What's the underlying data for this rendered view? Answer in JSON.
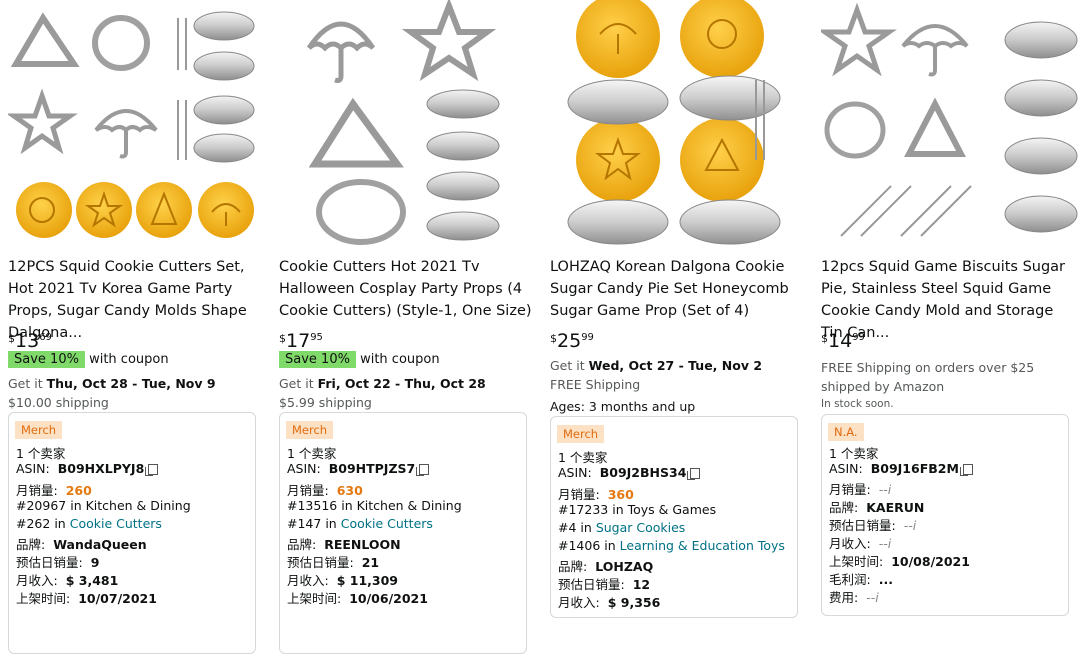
{
  "products": [
    {
      "title": "12PCS Squid Cookie Cutters Set, Hot 2021 Tv Korea Game Party Props, Sugar Candy Molds Shape Dalgona...",
      "price_dollar": "$",
      "price_whole": "13",
      "price_cents": "69",
      "coupon_badge": "Save 10%",
      "coupon_text": "with coupon",
      "delivery_prefix": "Get it",
      "delivery_dates": "Thu, Oct 28 - Tue, Nov 9",
      "shipping": "$10.00 shipping",
      "panel": {
        "tag": "Merch",
        "sellers": "1 个卖家",
        "asin_label": "ASIN:",
        "asin": "B09HXLPYJ8",
        "monthly_sales_label": "月销量:",
        "monthly_sales": "260",
        "rank1_num": "#20967",
        "rank1_text": "in Kitchen & Dining",
        "rank2_num": "#262",
        "rank2_in": "in",
        "rank2_link": "Cookie Cutters",
        "brand_label": "品牌:",
        "brand": "WandaQueen",
        "daily_label": "预估日销量:",
        "daily": "9",
        "revenue_label": "月收入:",
        "revenue": "$ 3,481",
        "date_label": "上架时间:",
        "date": "10/07/2021"
      }
    },
    {
      "title": "Cookie Cutters Hot 2021 Tv Halloween Cosplay Party Props (4 Cookie Cutters) (Style-1, One Size)",
      "price_dollar": "$",
      "price_whole": "17",
      "price_cents": "95",
      "coupon_badge": "Save 10%",
      "coupon_text": "with coupon",
      "delivery_prefix": "Get it",
      "delivery_dates": "Fri, Oct 22 - Thu, Oct 28",
      "shipping": "$5.99 shipping",
      "panel": {
        "tag": "Merch",
        "sellers": "1 个卖家",
        "asin_label": "ASIN:",
        "asin": "B09HTPJZS7",
        "monthly_sales_label": "月销量:",
        "monthly_sales": "630",
        "rank1_num": "#13516",
        "rank1_text": "in Kitchen & Dining",
        "rank2_num": "#147",
        "rank2_in": "in",
        "rank2_link": "Cookie Cutters",
        "brand_label": "品牌:",
        "brand": "REENLOON",
        "daily_label": "预估日销量:",
        "daily": "21",
        "revenue_label": "月收入:",
        "revenue": "$ 11,309",
        "date_label": "上架时间:",
        "date": "10/06/2021"
      }
    },
    {
      "title": "LOHZAQ Korean Dalgona Cookie Sugar Candy Pie Set Honeycomb Sugar Game Prop (Set of 4)",
      "price_dollar": "$",
      "price_whole": "25",
      "price_cents": "99",
      "delivery_prefix": "Get it",
      "delivery_dates": "Wed, Oct 27 - Tue, Nov 2",
      "shipping": "FREE Shipping",
      "ages": "Ages: 3 months and up",
      "panel": {
        "tag": "Merch",
        "sellers": "1 个卖家",
        "asin_label": "ASIN:",
        "asin": "B09J2BHS34",
        "monthly_sales_label": "月销量:",
        "monthly_sales": "360",
        "rank1_num": "#17233",
        "rank1_text": "in Toys & Games",
        "rank2_num": "#4",
        "rank2_in": "in",
        "rank2_link": "Sugar Cookies",
        "rank3_num": "#1406",
        "rank3_in": "in",
        "rank3_link": "Learning & Education Toys",
        "brand_label": "品牌:",
        "brand": "LOHZAQ",
        "daily_label": "预估日销量:",
        "daily": "12",
        "revenue_label": "月收入:",
        "revenue": "$ 9,356"
      }
    },
    {
      "title": "12pcs Squid Game Biscuits Sugar Pie, Stainless Steel Squid Game Cookie Candy Mold and Storage Tin Can...",
      "price_dollar": "$",
      "price_whole": "14",
      "price_cents": "99",
      "free_ship": "FREE Shipping on orders over $25 shipped by Amazon",
      "stock": "In stock soon.",
      "panel": {
        "tag": "N.A.",
        "sellers": "1 个卖家",
        "asin_label": "ASIN:",
        "asin": "B09J16FB2M",
        "monthly_sales_label": "月销量:",
        "monthly_sales": "--i",
        "brand_label": "品牌:",
        "brand": "KAERUN",
        "daily_label": "预估日销量:",
        "daily": "--i",
        "revenue_label": "月收入:",
        "revenue": "--i",
        "date_label": "上架时间:",
        "date": "10/08/2021",
        "profit_label": "毛利润:",
        "profit": "...",
        "fee_label": "费用:",
        "fee": "--i"
      }
    }
  ]
}
